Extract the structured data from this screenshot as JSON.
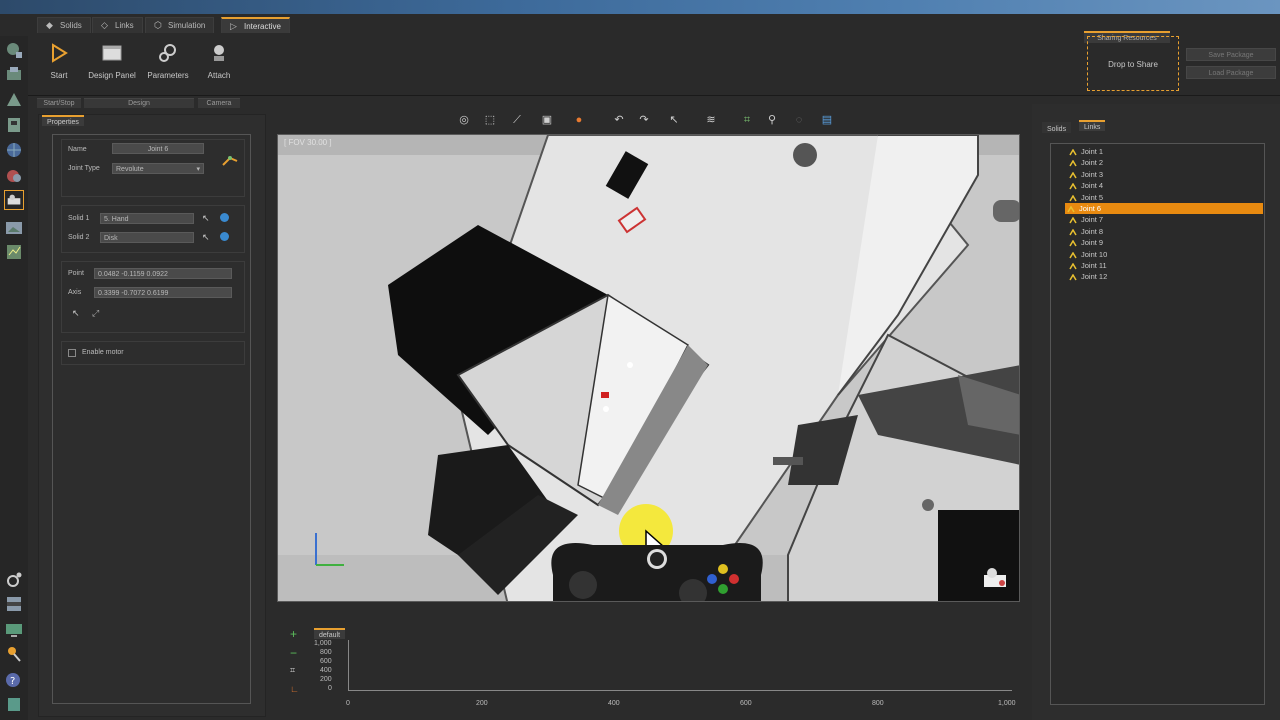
{
  "ribbon": {
    "tabs": [
      {
        "label": "Solids",
        "icon": "solids-icon"
      },
      {
        "label": "Links",
        "icon": "links-icon"
      },
      {
        "label": "Simulation",
        "icon": "simulation-icon"
      },
      {
        "label": "Interactive",
        "icon": "play-icon",
        "active": true
      }
    ],
    "buttons": [
      {
        "label": "Start",
        "icon": "start-icon"
      },
      {
        "label": "Design Panel",
        "icon": "design-panel-icon"
      },
      {
        "label": "Parameters",
        "icon": "parameters-icon"
      },
      {
        "label": "Attach",
        "icon": "attach-icon"
      }
    ],
    "groups": [
      "Start/Stop",
      "Design",
      "Camera"
    ],
    "sharing": {
      "title": "Sharing Resources",
      "drop_label": "Drop to Share",
      "save_label": "Save Package",
      "load_label": "Load Package"
    }
  },
  "properties": {
    "tab_label": "Properties",
    "name_label": "Name",
    "name_value": "Joint 6",
    "joint_type_label": "Joint Type",
    "joint_type_value": "Revolute",
    "solid1_label": "Solid 1",
    "solid1_value": "5. Hand",
    "solid2_label": "Solid 2",
    "solid2_value": "Disk",
    "point_label": "Point",
    "point_value": "0.0482 -0.1159 0.0922",
    "axis_label": "Axis",
    "axis_value": "0.3399 -0.7072 0.6199",
    "enable_motor_label": "Enable motor",
    "enable_motor_checked": false
  },
  "viewport": {
    "fov_label": "[ FOV 30.00 ]",
    "toolbar_icons": [
      "orbit-icon",
      "zoom-box-icon",
      "measure-icon",
      "view-cube-icon",
      "render-mode-icon",
      "undo-icon",
      "redo-icon",
      "select-icon",
      "align-icon",
      "fit-icon",
      "zoom-icon",
      "hide-icon",
      "screenshot-icon"
    ]
  },
  "timeline": {
    "tab_label": "default",
    "y_ticks": [
      "1,000",
      "800",
      "600",
      "400",
      "200",
      "0"
    ],
    "x_ticks": [
      "0",
      "200",
      "400",
      "600",
      "800",
      "1,000"
    ]
  },
  "links_panel": {
    "tabs": [
      "Solids",
      "Links"
    ],
    "active_tab": "Links",
    "items": [
      "Joint 1",
      "Joint 2",
      "Joint 3",
      "Joint 4",
      "Joint 5",
      "Joint 6",
      "Joint 7",
      "Joint 8",
      "Joint 9",
      "Joint 10",
      "Joint 11",
      "Joint 12"
    ],
    "selected": "Joint 6"
  },
  "colors": {
    "accent": "#e8a030",
    "selection": "#e88a10",
    "panel_bg": "#2e2e2e",
    "viewport_bg": "#c9c9c9"
  }
}
